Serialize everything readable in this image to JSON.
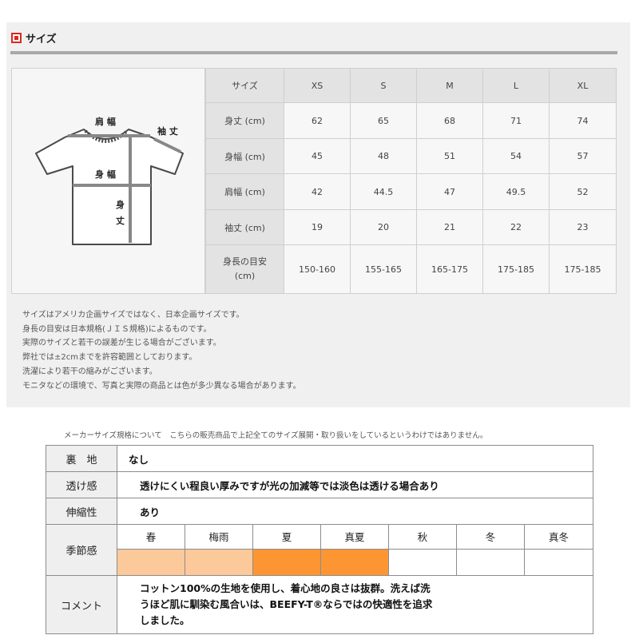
{
  "header": {
    "title": "サイズ",
    "accent": "#d9291c"
  },
  "diagram": {
    "labels": {
      "shoulder": "肩 幅",
      "sleeve": "袖 丈",
      "chest": "身 幅",
      "length_top": "身",
      "length_bottom": "丈"
    }
  },
  "size_table": {
    "corner": "サイズ",
    "sizes": [
      "XS",
      "S",
      "M",
      "L",
      "XL"
    ],
    "rows": [
      {
        "label": "身丈 (cm)",
        "values": [
          "62",
          "65",
          "68",
          "71",
          "74"
        ]
      },
      {
        "label": "身幅 (cm)",
        "values": [
          "45",
          "48",
          "51",
          "54",
          "57"
        ]
      },
      {
        "label": "肩幅 (cm)",
        "values": [
          "42",
          "44.5",
          "47",
          "49.5",
          "52"
        ]
      },
      {
        "label": "袖丈 (cm)",
        "values": [
          "19",
          "20",
          "21",
          "22",
          "23"
        ]
      },
      {
        "label_line1": "身長の目安",
        "label_line2": "(cm)",
        "values": [
          "150-160",
          "155-165",
          "165-175",
          "175-185",
          "175-185"
        ]
      }
    ]
  },
  "notes": [
    "サイズはアメリカ企画サイズではなく、日本企画サイズです。",
    "身長の目安は日本規格(ＪＩＳ規格)によるものです。",
    "実際のサイズと若干の誤差が生じる場合がございます。",
    "弊社では±2cmまでを許容範囲としております。",
    "洗濯により若干の縮みがございます。",
    "モニタなどの環境で、写真と実際の商品とは色が多少異なる場合があります。"
  ],
  "maker_note": "メーカーサイズ規格について　こちらの販売商品で上記全てのサイズ展開・取り扱いをしているというわけではありません。",
  "fabric": {
    "lining": {
      "key": "裏　地",
      "value": "なし"
    },
    "sheer": {
      "key": "透け感",
      "value": "透けにくい程良い厚みですが光の加減等では淡色は透ける場合あり"
    },
    "stretch": {
      "key": "伸縮性",
      "value": "あり"
    },
    "season": {
      "key": "季節感",
      "names": [
        "春",
        "梅雨",
        "夏",
        "真夏",
        "秋",
        "冬",
        "真冬"
      ],
      "colors": [
        "#fcc99a",
        "#fcc99a",
        "#fd9632",
        "#fd9632",
        "#ffffff",
        "#ffffff",
        "#ffffff"
      ]
    },
    "comment": {
      "key": "コメント",
      "lines": [
        "コットン100%の生地を使用し、着心地の良さは抜群。洗えば洗",
        "うほど肌に馴染む風合いは、BEEFY-T®ならではの快適性を追求",
        "しました。"
      ]
    }
  }
}
